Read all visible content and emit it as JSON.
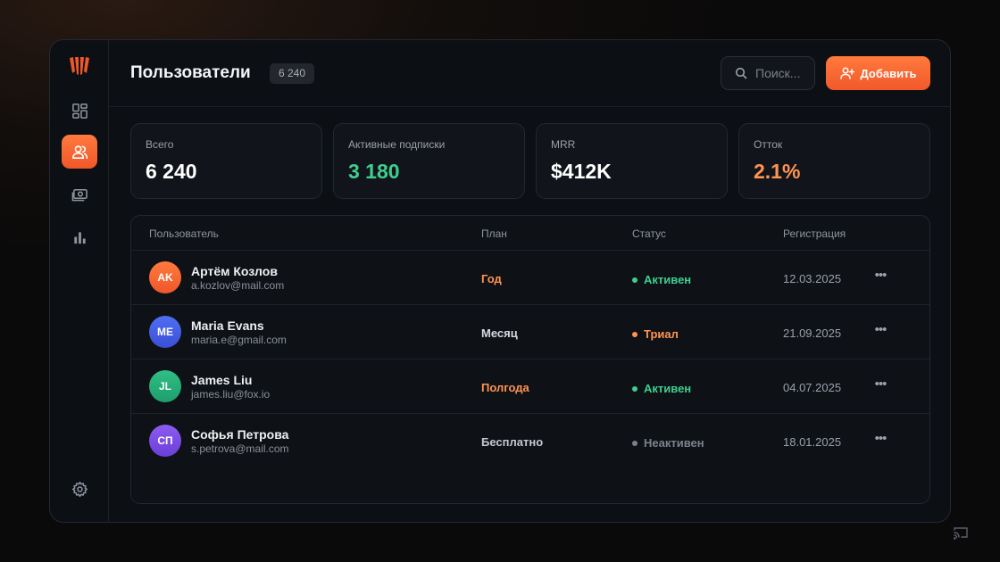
{
  "header": {
    "title": "Пользователи",
    "count": "6 240",
    "search_placeholder": "Поиск...",
    "add_label": "Добавить"
  },
  "sidebar": {
    "items": [
      {
        "name": "logo-icon"
      },
      {
        "name": "dashboard-icon"
      },
      {
        "name": "users-icon",
        "active": true
      },
      {
        "name": "payments-icon"
      },
      {
        "name": "analytics-icon"
      },
      {
        "name": "settings-icon"
      }
    ]
  },
  "kpis": [
    {
      "label": "Всего",
      "value": "6 240",
      "color": "#ffffff"
    },
    {
      "label": "Активные подписки",
      "value": "3 180",
      "color": "#3ecf8e"
    },
    {
      "label": "MRR",
      "value": "$412K",
      "color": "#ffffff"
    },
    {
      "label": "Отток",
      "value": "2.1%",
      "color": "#ff9452"
    }
  ],
  "table": {
    "columns": [
      "Пользователь",
      "План",
      "Статус",
      "Регистрация"
    ],
    "rows": [
      {
        "initials": "AK",
        "name": "Артём Козлов",
        "email": "a.kozlov@mail.com",
        "plan": "Год",
        "status": "Активен",
        "date": "12.03.2025"
      },
      {
        "initials": "ME",
        "name": "Maria Evans",
        "email": "maria.e@gmail.com",
        "plan": "Месяц",
        "status": "Триал",
        "date": "21.09.2025"
      },
      {
        "initials": "JL",
        "name": "James Liu",
        "email": "james.liu@fox.io",
        "plan": "Полгода",
        "status": "Активен",
        "date": "04.07.2025"
      },
      {
        "initials": "СП",
        "name": "Софья Петрова",
        "email": "s.petrova@mail.com",
        "plan": "Бесплатно",
        "status": "Неактивен",
        "date": "18.01.2025"
      }
    ]
  },
  "colors": {
    "accent": "#ff6a35",
    "active": "#3ecf8e",
    "trial": "#ff9452",
    "inactive": "#7c818b"
  }
}
